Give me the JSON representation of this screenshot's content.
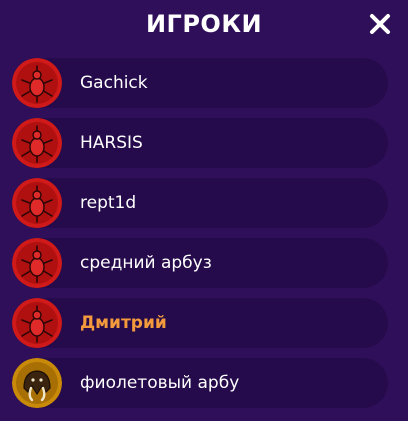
{
  "header": {
    "title": "ИГРОКИ",
    "close_icon": "close-icon"
  },
  "colors": {
    "background": "#2f0f5a",
    "row": "#250b4b",
    "text": "#ffffff",
    "highlight": "#f29a3c",
    "avatar_red": "#d01a1a",
    "avatar_gold": "#c98a0a"
  },
  "players": [
    {
      "name": "Gachick",
      "avatar": "red-insect-avatar-icon"
    },
    {
      "name": "HARSIS",
      "avatar": "red-insect-avatar-icon"
    },
    {
      "name": "rept1d",
      "avatar": "red-insect-avatar-icon"
    },
    {
      "name": "средний арбуз",
      "avatar": "red-insect-avatar-icon"
    },
    {
      "name": "Дмитрий",
      "avatar": "red-insect-avatar-icon",
      "is_self": true
    },
    {
      "name": "фиолетовый арбу",
      "avatar": "mammoth-avatar-icon"
    }
  ]
}
